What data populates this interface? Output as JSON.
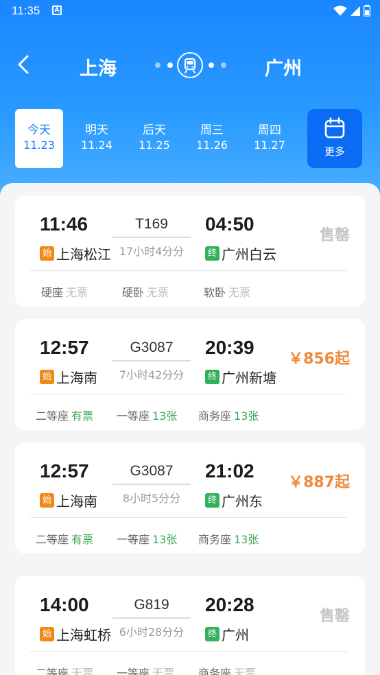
{
  "status_bar": {
    "time": "11:35",
    "notif_icon": "A"
  },
  "route": {
    "from": "上海",
    "to": "广州"
  },
  "dates": [
    {
      "weekday": "今天",
      "date": "11.23",
      "active": true
    },
    {
      "weekday": "明天",
      "date": "11.24"
    },
    {
      "weekday": "后天",
      "date": "11.25"
    },
    {
      "weekday": "周三",
      "date": "11.26"
    },
    {
      "weekday": "周四",
      "date": "11.27"
    }
  ],
  "more_label": "更多",
  "tags": {
    "start": "始",
    "end": "终"
  },
  "colors": {
    "accent": "#1a86ff",
    "price": "#ef8a3c",
    "available": "#3aa757",
    "start_tag": "#f08a14",
    "end_tag": "#33b05a"
  },
  "trains": [
    {
      "dep_time": "11:46",
      "train_no": "T169",
      "arr_time": "04:50",
      "from_station": "上海松江",
      "duration": "17小时4分分",
      "to_station": "广州白云",
      "price": "售罄",
      "sold_out": true,
      "seats": [
        {
          "name": "硬座",
          "status": "无票",
          "state": "none"
        },
        {
          "name": "硬卧",
          "status": "无票",
          "state": "none"
        },
        {
          "name": "软卧",
          "status": "无票",
          "state": "none"
        }
      ]
    },
    {
      "dep_time": "12:57",
      "train_no": "G3087",
      "arr_time": "20:39",
      "from_station": "上海南",
      "duration": "7小时42分分",
      "to_station": "广州新塘",
      "price": "￥856起",
      "sold_out": false,
      "seats": [
        {
          "name": "二等座",
          "status": "有票",
          "state": "avail"
        },
        {
          "name": "一等座",
          "status": "13张",
          "state": "avail"
        },
        {
          "name": "商务座",
          "status": "13张",
          "state": "avail"
        }
      ]
    },
    {
      "dep_time": "12:57",
      "train_no": "G3087",
      "arr_time": "21:02",
      "from_station": "上海南",
      "duration": "8小时5分分",
      "to_station": "广州东",
      "price": "￥887起",
      "sold_out": false,
      "seats": [
        {
          "name": "二等座",
          "status": "有票",
          "state": "avail"
        },
        {
          "name": "一等座",
          "status": "13张",
          "state": "avail"
        },
        {
          "name": "商务座",
          "status": "13张",
          "state": "avail"
        }
      ]
    },
    {
      "dep_time": "14:00",
      "train_no": "G819",
      "arr_time": "20:28",
      "from_station": "上海虹桥",
      "duration": "6小时28分分",
      "to_station": "广州",
      "price": "售罄",
      "sold_out": true,
      "seats": [
        {
          "name": "二等座",
          "status": "无票",
          "state": "none"
        },
        {
          "name": "一等座",
          "status": "无票",
          "state": "none"
        },
        {
          "name": "商务座",
          "status": "无票",
          "state": "none"
        }
      ]
    }
  ]
}
